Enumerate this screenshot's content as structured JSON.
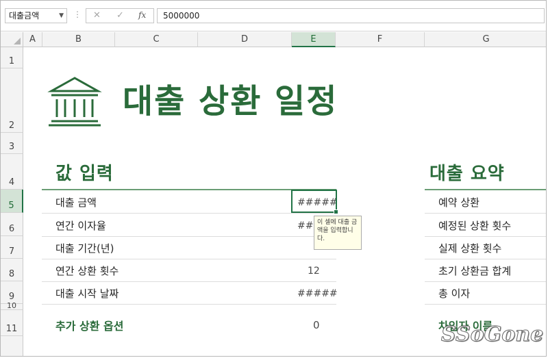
{
  "formula_bar": {
    "name_box": "대출금액",
    "cancel_icon": "✕",
    "enter_icon": "✓",
    "fx_label": "fx",
    "value": "5000000"
  },
  "columns": [
    "A",
    "B",
    "C",
    "D",
    "E",
    "F",
    "G"
  ],
  "rows": [
    "1",
    "2",
    "3",
    "4",
    "5",
    "6",
    "7",
    "8",
    "9",
    "10",
    "11"
  ],
  "sheet": {
    "title": "대출 상환 일정",
    "input_section": {
      "heading": "값 입력",
      "items": [
        {
          "label": "대출 금액",
          "value": "#####"
        },
        {
          "label": "연간 이자율",
          "value": "###"
        },
        {
          "label": "대출 기간(년)",
          "value": ""
        },
        {
          "label": "연간 상환 횟수",
          "value": "12"
        },
        {
          "label": "대출 시작 날짜",
          "value": "#####"
        }
      ],
      "extra_label": "추가 상환 옵션",
      "extra_value": "0"
    },
    "summary_section": {
      "heading": "대출 요약",
      "items": [
        "예약 상환",
        "예정된 상환 횟수",
        "실제 상환 횟수",
        "초기 상환금 합계",
        "총 이자"
      ],
      "last_label": "차입자 이름"
    },
    "tooltip": "이 셀에 대출 금액을 입력합니다."
  },
  "watermark": "SSoGone",
  "colors": {
    "accent": "#2a6b3a",
    "excel_green": "#217346"
  }
}
